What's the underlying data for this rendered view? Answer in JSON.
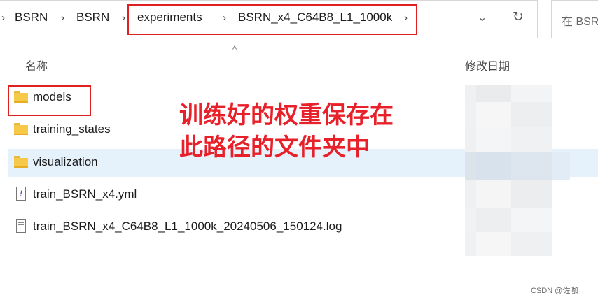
{
  "address_bar": {
    "crumbs": [
      "BSRN",
      "BSRN",
      "experiments",
      "BSRN_x4_C64B8_L1_1000k"
    ],
    "separator": "›",
    "dropdown_icon": "chevron-down-icon",
    "refresh_icon": "refresh-icon"
  },
  "search": {
    "placeholder": "在 BSRN"
  },
  "columns": {
    "name": "名称",
    "date_modified": "修改日期"
  },
  "files": [
    {
      "name": "models",
      "type": "folder"
    },
    {
      "name": "training_states",
      "type": "folder"
    },
    {
      "name": "visualization",
      "type": "folder",
      "selected": true
    },
    {
      "name": "train_BSRN_x4.yml",
      "type": "yml"
    },
    {
      "name": "train_BSRN_x4_C64B8_L1_1000k_20240506_150124.log",
      "type": "log"
    }
  ],
  "annotation": {
    "line1": "训练好的权重保存在",
    "line2": "此路径的文件夹中"
  },
  "watermark": "CSDN @佐咖",
  "colors": {
    "highlight": "#e02020",
    "annotation": "#e8202a",
    "selected_row": "#e5f1fb",
    "folder": "#f7c948"
  }
}
